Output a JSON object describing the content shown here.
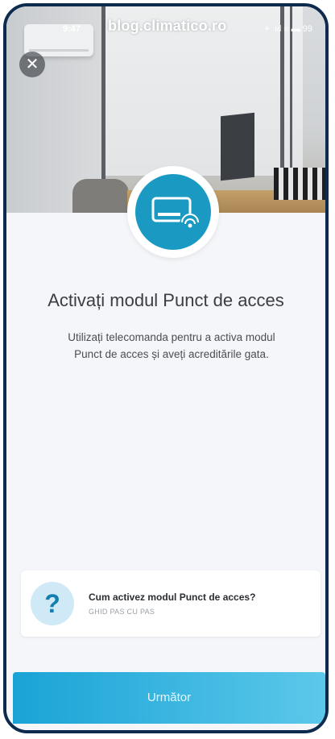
{
  "watermark": "blog.climatico.ro",
  "status_bar": {
    "time": "9:47",
    "icons_text": "⌖ .ııl ≋ ▬ 99"
  },
  "header": {
    "close_icon": "close-icon"
  },
  "hero": {
    "icon": "ac-remote-wifi-icon",
    "accent": "#1a9ac2"
  },
  "main": {
    "title": "Activați modul Punct de acces",
    "subtitle": "Utilizați telecomanda pentru a activa modul Punct de acces și aveți acreditările gata."
  },
  "help": {
    "icon": "question-icon",
    "title": "Cum activez modul Punct de acces?",
    "subtitle": "GHID PAS CU PAS"
  },
  "footer": {
    "next_label": "Următor",
    "accent": "#1aa3d6"
  }
}
